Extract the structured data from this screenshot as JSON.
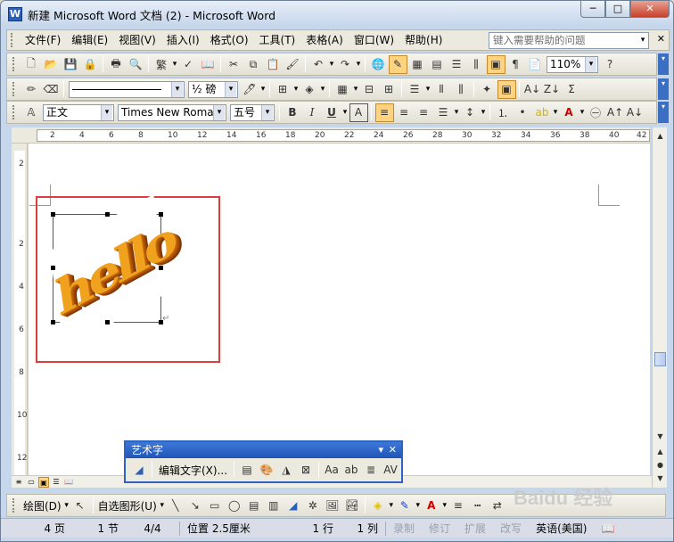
{
  "window": {
    "title": "新建 Microsoft Word 文档 (2) - Microsoft Word",
    "min": "─",
    "max": "□",
    "close": "✕",
    "app_icon": "W"
  },
  "menus": [
    "文件(F)",
    "编辑(E)",
    "视图(V)",
    "插入(I)",
    "格式(O)",
    "工具(T)",
    "表格(A)",
    "窗口(W)",
    "帮助(H)"
  ],
  "help": {
    "placeholder": "键入需要帮助的问题"
  },
  "toolbar1": {
    "zoom": "110%"
  },
  "toolbar2": {
    "line_weight": "½ 磅"
  },
  "toolbar3": {
    "style": "正文",
    "font": "Times New Roman",
    "size": "五号"
  },
  "ruler": {
    "ticks": [
      "2",
      "4",
      "6",
      "8",
      "10",
      "12",
      "14",
      "16",
      "18",
      "20",
      "22",
      "24",
      "26",
      "28",
      "30",
      "32",
      "34",
      "36",
      "38",
      "40",
      "42"
    ]
  },
  "vruler": {
    "ticks": [
      "2",
      "2",
      "4",
      "6",
      "8",
      "10",
      "12"
    ]
  },
  "wordart_text": "hello",
  "wordart_toolbar": {
    "title": "艺术字",
    "edit_text": "编辑文字(X)..."
  },
  "draw_toolbar": {
    "draw": "绘图(D)",
    "autoshapes": "自选图形(U)"
  },
  "status": {
    "page": "4 页",
    "section": "1 节",
    "pages": "4/4",
    "position": "位置 2.5厘米",
    "line": "1 行",
    "col": "1 列",
    "rec": "录制",
    "rev": "修订",
    "ext": "扩展",
    "ovr": "改写",
    "lang": "英语(美国)"
  },
  "watermark": "Baidu 经验",
  "colors": {
    "title_gradient": "#c4d5ea",
    "highlight": "#e23b3b",
    "wordart_face": "#f0a21f",
    "wordart_side": "#a94f05",
    "toolbar_title": "#2f63c3"
  }
}
